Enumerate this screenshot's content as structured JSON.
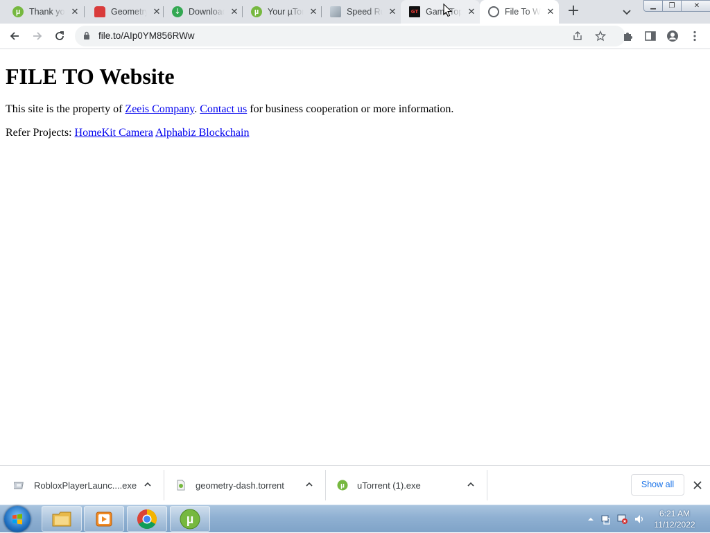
{
  "browser": {
    "tabs": [
      {
        "title": "Thank you",
        "icon": "utorrent-icon"
      },
      {
        "title": "Geometry",
        "icon": "ghost-icon"
      },
      {
        "title": "Download",
        "icon": "download-icon"
      },
      {
        "title": "Your µTorrent",
        "icon": "utorrent-icon"
      },
      {
        "title": "Speed Run",
        "icon": "speed-icon"
      },
      {
        "title": "GameTop",
        "icon": "gametop-icon"
      },
      {
        "title": "File To Website",
        "icon": "globe-icon",
        "active": true
      }
    ],
    "url": "file.to/AIp0YM856RWw"
  },
  "page": {
    "heading": "FILE TO Website",
    "p1": {
      "prefix": "This site is the property of ",
      "company_link": "Zeeis Company",
      "middle": ". ",
      "contact_link": "Contact us",
      "suffix": " for business cooperation or more information."
    },
    "p2": {
      "prefix": "Refer Projects: ",
      "link1": "HomeKit Camera",
      "link2": "Alphabiz Blockchain"
    }
  },
  "downloads": {
    "items": [
      {
        "name": "RobloxPlayerLaunc....exe",
        "icon": "roblox-file-icon"
      },
      {
        "name": "geometry-dash.torrent",
        "icon": "torrent-file-icon"
      },
      {
        "name": "uTorrent (1).exe",
        "icon": "utorrent-icon"
      }
    ],
    "show_all": "Show all"
  },
  "taskbar": {
    "apps": [
      "explorer",
      "media-player",
      "chrome",
      "utorrent"
    ],
    "time": "6:21 AM",
    "date": "11/12/2022"
  },
  "colors": {
    "tabstrip": "#dee1e6",
    "link": "#0000ee",
    "accent": "#1a73e8"
  }
}
